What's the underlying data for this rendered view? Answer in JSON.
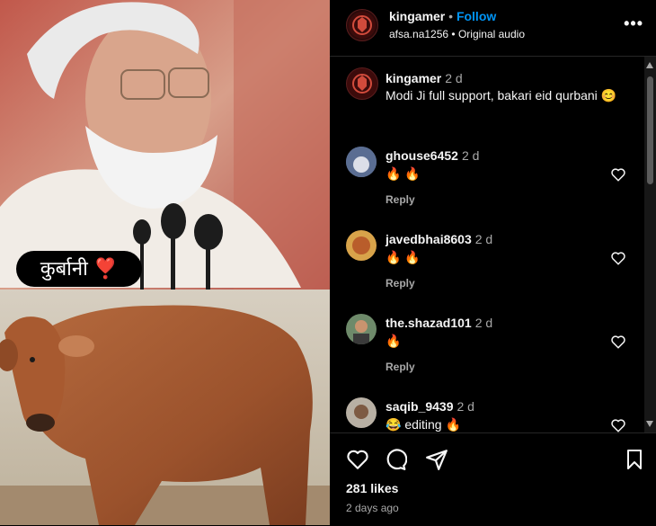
{
  "post": {
    "username": "kingamer",
    "follow_label": "Follow",
    "separator": "•",
    "subtitle_user": "afsa.na1256",
    "subtitle_audio": "Original audio",
    "more_label": "•••",
    "caption_text": "Modi Ji full support, bakari eid qurbani 😊",
    "caption_time": "2 d",
    "overlay_text": "कुर्बानी ❣️"
  },
  "comments": [
    {
      "user": "ghouse6452",
      "time": "2 d",
      "text": "🔥 🔥",
      "reply": "Reply"
    },
    {
      "user": "javedbhai8603",
      "time": "2 d",
      "text": "🔥 🔥",
      "reply": "Reply"
    },
    {
      "user": "the.shazad101",
      "time": "2 d",
      "text": "🔥",
      "reply": "Reply"
    },
    {
      "user": "saqib_9439",
      "time": "2 d",
      "text": "😂 editing 🔥",
      "reply": ""
    }
  ],
  "footer": {
    "likes": "281 likes",
    "ago": "2 days ago"
  },
  "icons": {
    "like": "heart-icon",
    "comment": "comment-icon",
    "share": "send-icon",
    "save": "bookmark-icon"
  },
  "colors": {
    "follow": "#0095f6",
    "muted": "#a8a8a8",
    "background": "#000000"
  }
}
